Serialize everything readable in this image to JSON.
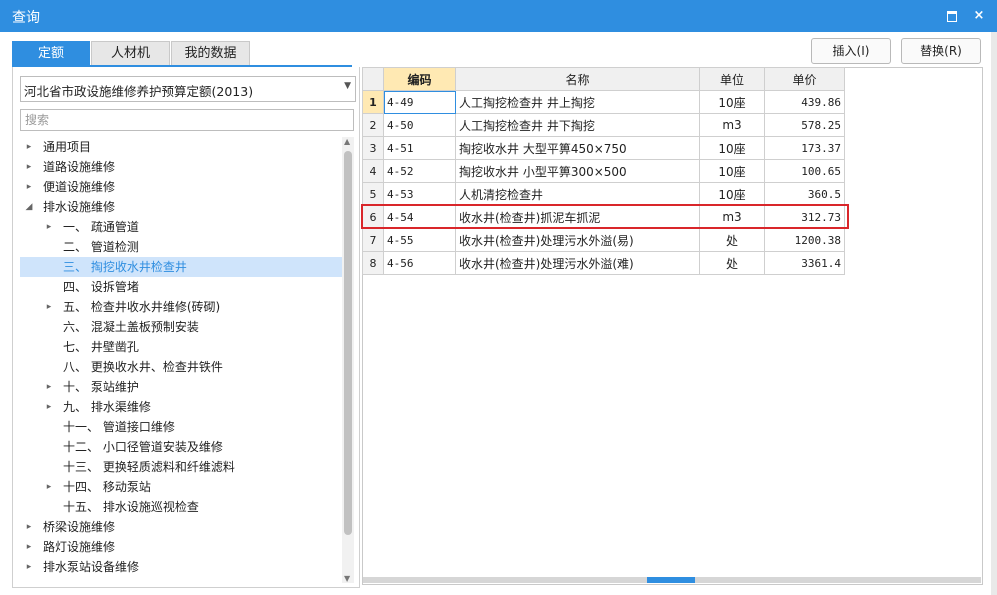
{
  "window": {
    "title": "查询",
    "maximize_label": "",
    "close_label": "×"
  },
  "tabs": [
    {
      "label": "定额",
      "active": true
    },
    {
      "label": "人材机",
      "active": false
    },
    {
      "label": "我的数据",
      "active": false
    }
  ],
  "toolbar": {
    "insert_label": "插入(I)",
    "replace_label": "替换(R)"
  },
  "quota_select": {
    "value": "河北省市政设施维修养护预算定额(2013)"
  },
  "search": {
    "placeholder": "搜索"
  },
  "tree": [
    {
      "label": "通用项目",
      "expander": "▸",
      "level": 0
    },
    {
      "label": "道路设施维修",
      "expander": "▸",
      "level": 0
    },
    {
      "label": "便道设施维修",
      "expander": "▸",
      "level": 0
    },
    {
      "label": "排水设施维修",
      "expander": "◢",
      "level": 0
    },
    {
      "label": "一、 疏通管道",
      "expander": "▸",
      "level": 1
    },
    {
      "label": "二、 管道检测",
      "expander": "",
      "level": 1
    },
    {
      "label": "三、 掏挖收水井检查井",
      "expander": "",
      "level": 1,
      "selected": true
    },
    {
      "label": "四、 设拆管堵",
      "expander": "",
      "level": 1
    },
    {
      "label": "五、 检查井收水井维修(砖砌)",
      "expander": "▸",
      "level": 1
    },
    {
      "label": "六、 混凝土盖板预制安装",
      "expander": "",
      "level": 1
    },
    {
      "label": "七、 井壁凿孔",
      "expander": "",
      "level": 1
    },
    {
      "label": "八、 更换收水井、检查井铁件",
      "expander": "",
      "level": 1
    },
    {
      "label": "十、 泵站维护",
      "expander": "▸",
      "level": 1
    },
    {
      "label": "九、 排水渠维修",
      "expander": "▸",
      "level": 1
    },
    {
      "label": "十一、 管道接口维修",
      "expander": "",
      "level": 1
    },
    {
      "label": "十二、 小口径管道安装及维修",
      "expander": "",
      "level": 1
    },
    {
      "label": "十三、 更换轻质滤料和纤维滤料",
      "expander": "",
      "level": 1
    },
    {
      "label": "十四、 移动泵站",
      "expander": "▸",
      "level": 1
    },
    {
      "label": "十五、 排水设施巡视检查",
      "expander": "",
      "level": 1
    },
    {
      "label": "桥梁设施维修",
      "expander": "▸",
      "level": 0
    },
    {
      "label": "路灯设施维修",
      "expander": "▸",
      "level": 0
    },
    {
      "label": "排水泵站设备维修",
      "expander": "▸",
      "level": 0
    }
  ],
  "grid": {
    "columns": [
      "编码",
      "名称",
      "单位",
      "单价"
    ],
    "rows": [
      {
        "no": "1",
        "code": "4-49",
        "name": "人工掏挖检查井 井上掏挖",
        "unit": "10座",
        "price": "439.86"
      },
      {
        "no": "2",
        "code": "4-50",
        "name": "人工掏挖检查井 井下掏挖",
        "unit": "m3",
        "price": "578.25"
      },
      {
        "no": "3",
        "code": "4-51",
        "name": "掏挖收水井 大型平箅450×750",
        "unit": "10座",
        "price": "173.37"
      },
      {
        "no": "4",
        "code": "4-52",
        "name": "掏挖收水井 小型平箅300×500",
        "unit": "10座",
        "price": "100.65"
      },
      {
        "no": "5",
        "code": "4-53",
        "name": "人机清挖检查井",
        "unit": "10座",
        "price": "360.5"
      },
      {
        "no": "6",
        "code": "4-54",
        "name": "收水井(检查井)抓泥车抓泥",
        "unit": "m3",
        "price": "312.73"
      },
      {
        "no": "7",
        "code": "4-55",
        "name": "收水井(检查井)处理污水外溢(易)",
        "unit": "处",
        "price": "1200.38"
      },
      {
        "no": "8",
        "code": "4-56",
        "name": "收水井(检查井)处理污水外溢(难)",
        "unit": "处",
        "price": "3361.4"
      }
    ]
  },
  "colors": {
    "accent": "#2f8ee0",
    "highlight_border": "#d9262a",
    "selected_bg": "#cfe4fb",
    "header_active": "#ffe9b3"
  }
}
